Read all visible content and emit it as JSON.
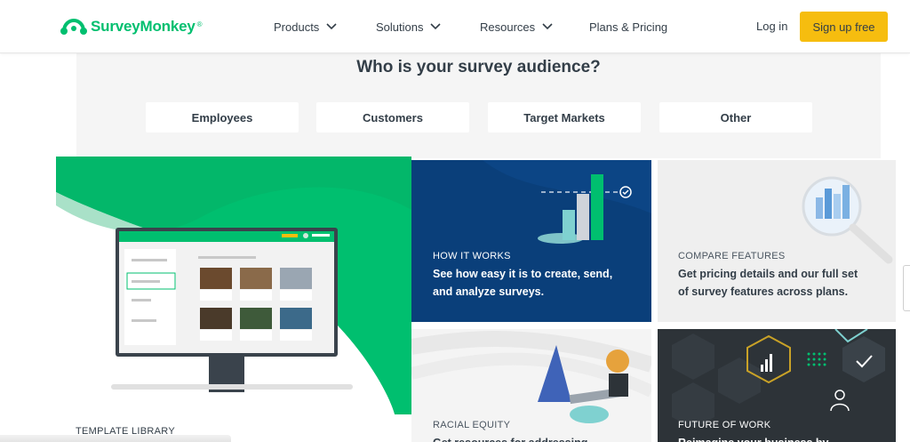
{
  "brand": {
    "name": "SurveyMonkey",
    "tm": "®",
    "color": "#00bf6f"
  },
  "nav": {
    "products": "Products",
    "solutions": "Solutions",
    "resources": "Resources",
    "plans": "Plans & Pricing",
    "login": "Log in",
    "signup": "Sign up free"
  },
  "audience": {
    "title": "Who is your survey audience?",
    "options": [
      "Employees",
      "Customers",
      "Target Markets",
      "Other"
    ]
  },
  "cards": {
    "template": {
      "label": "TEMPLATE LIBRARY"
    },
    "how": {
      "label": "HOW IT WORKS",
      "desc_line1": "See how easy it is to create, send,",
      "desc_line2": "and analyze surveys."
    },
    "compare": {
      "label": "COMPARE FEATURES",
      "desc_line1": "Get pricing details and our full set",
      "desc_line2": "of survey features across plans."
    },
    "racial": {
      "label": "RACIAL EQUITY",
      "desc_line1": "Get resources for addressing"
    },
    "future": {
      "label": "FUTURE OF WORK",
      "desc_line1": "Reimagine your business by"
    }
  },
  "colors": {
    "accent_yellow": "#f6bd0f",
    "brand_green": "#00bf6f",
    "navy": "#0a3f7a",
    "dark": "#2d3338"
  }
}
